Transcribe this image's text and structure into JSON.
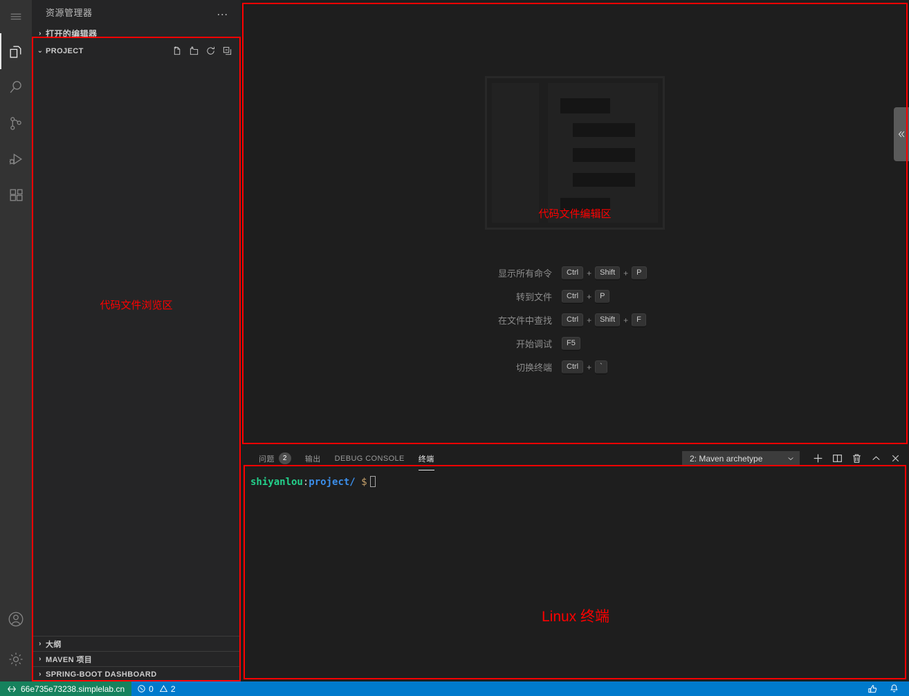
{
  "activity_bar": {
    "items": [
      {
        "name": "menu",
        "icon": "hamburger-menu-icon",
        "label": "菜单"
      },
      {
        "name": "explorer",
        "icon": "files-icon",
        "label": "资源管理器",
        "active": true
      },
      {
        "name": "search",
        "icon": "search-icon",
        "label": "搜索"
      },
      {
        "name": "source-control",
        "icon": "source-control-icon",
        "label": "源代码管理"
      },
      {
        "name": "debug",
        "icon": "run-and-debug-icon",
        "label": "运行和调试"
      },
      {
        "name": "extensions",
        "icon": "extensions-icon",
        "label": "扩展"
      }
    ],
    "bottom_items": [
      {
        "name": "accounts",
        "icon": "account-icon",
        "label": "账户"
      },
      {
        "name": "settings",
        "icon": "gear-icon",
        "label": "管理"
      }
    ]
  },
  "sidebar": {
    "title": "资源管理器",
    "more_actions": "...",
    "sections": [
      {
        "label": "打开的编辑器",
        "expanded": false,
        "twisty": "›"
      },
      {
        "label": "PROJECT",
        "expanded": true,
        "twisty": "⌄"
      }
    ],
    "project_actions": [
      {
        "name": "new-file-icon",
        "label": "新建文件"
      },
      {
        "name": "new-folder-icon",
        "label": "新建文件夹"
      },
      {
        "name": "refresh-icon",
        "label": "刷新资源管理器"
      },
      {
        "name": "collapse-all-icon",
        "label": "在资源管理器中折叠文件夹"
      }
    ],
    "bottom_sections": [
      {
        "label": "大纲",
        "twisty": "›"
      },
      {
        "label": "MAVEN 项目",
        "twisty": "›"
      },
      {
        "label": "SPRING-BOOT DASHBOARD",
        "twisty": "›"
      }
    ]
  },
  "annotations": {
    "sidebar": "代码文件浏览区",
    "editor": "代码文件编辑区",
    "terminal": "Linux 终端",
    "color": "#ff0000"
  },
  "editor": {
    "shortcuts": [
      {
        "label": "显示所有命令",
        "keys": [
          "Ctrl",
          "Shift",
          "P"
        ]
      },
      {
        "label": "转到文件",
        "keys": [
          "Ctrl",
          "P"
        ]
      },
      {
        "label": "在文件中查找",
        "keys": [
          "Ctrl",
          "Shift",
          "F"
        ]
      },
      {
        "label": "开始调试",
        "keys": [
          "F5"
        ]
      },
      {
        "label": "切换终端",
        "keys": [
          "Ctrl",
          "`"
        ]
      }
    ],
    "key_separator": "+",
    "collapse_handle_icon": "chevron-double-left-icon"
  },
  "panel": {
    "tabs": [
      {
        "label": "问题",
        "badge": "2",
        "active": false
      },
      {
        "label": "输出",
        "badge": null,
        "active": false
      },
      {
        "label": "DEBUG CONSOLE",
        "badge": null,
        "active": false
      },
      {
        "label": "终端",
        "badge": null,
        "active": true
      }
    ],
    "terminal_select": {
      "value": "2: Maven archetype",
      "chevron": "⌄"
    },
    "actions": [
      {
        "name": "new-terminal-icon",
        "label": "+"
      },
      {
        "name": "split-terminal-icon",
        "label": "拆分终端"
      },
      {
        "name": "kill-terminal-icon",
        "label": "终止终端"
      },
      {
        "name": "maximize-panel-icon",
        "label": "最大化面板大小"
      },
      {
        "name": "close-panel-icon",
        "label": "关闭面板"
      }
    ]
  },
  "terminal": {
    "user": "shiyanlou",
    "colon": ":",
    "path": "project/",
    "dollar": "$"
  },
  "status_bar": {
    "remote": {
      "icon": "remote-icon",
      "label": "66e735e73238.simplelab.cn",
      "color": "#16825d"
    },
    "problems": {
      "error_icon": "error-icon",
      "errors": "0",
      "warning_icon": "warning-icon",
      "warnings": "2"
    },
    "right_items": [
      {
        "name": "feedback-icon",
        "label": "发送反馈"
      },
      {
        "name": "bell-icon",
        "label": "无通知"
      }
    ],
    "background": "#007acc"
  }
}
